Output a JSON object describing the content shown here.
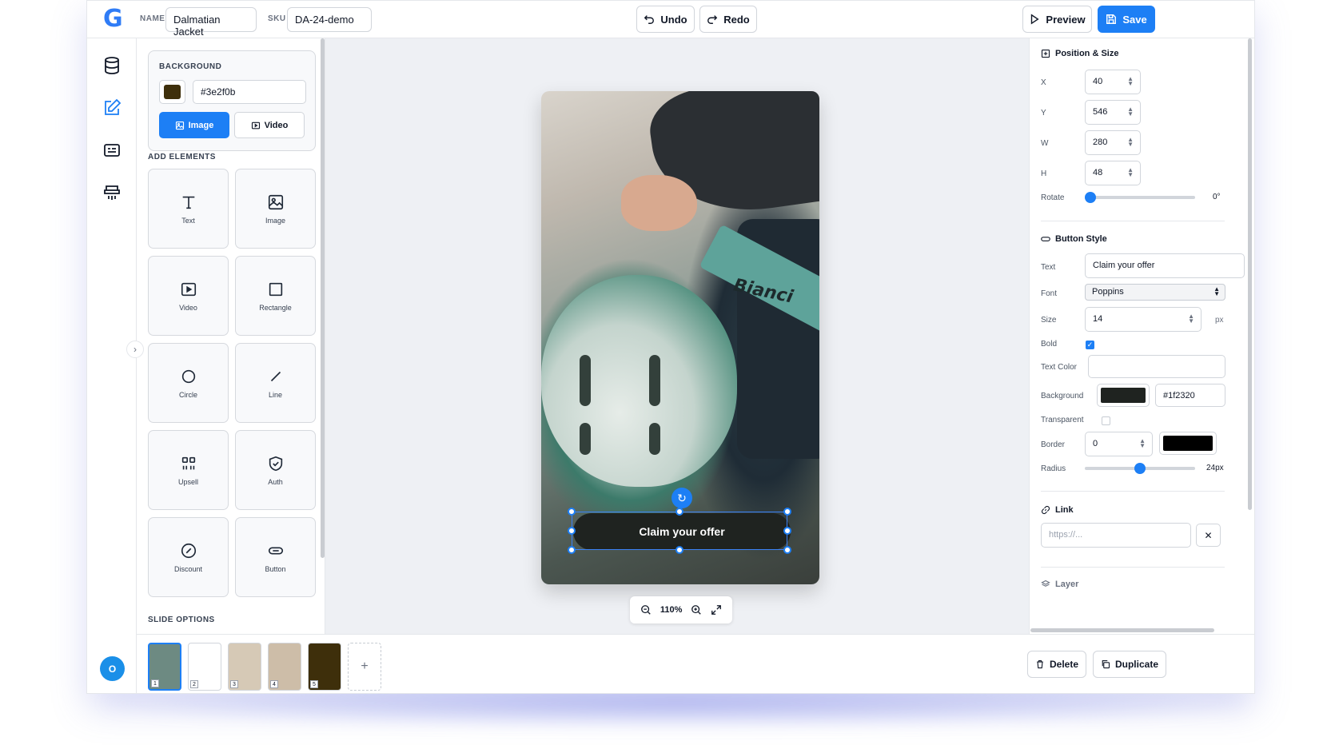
{
  "brand": {
    "logo_glyph": "G",
    "accent": "#1d7ff5"
  },
  "header": {
    "name_label": "NAME",
    "name_value": "Dalmatian Jacket",
    "sku_label": "SKU",
    "sku_value": "DA-24-demo",
    "undo_label": "Undo",
    "redo_label": "Redo",
    "preview_label": "Preview",
    "save_label": "Save"
  },
  "rail": {
    "items": [
      "database-icon",
      "edit-icon",
      "card-icon",
      "upload-icon"
    ],
    "active": "edit-icon",
    "avatar_initial": "O"
  },
  "left_panel": {
    "background": {
      "title": "BACKGROUND",
      "color_hex": "#3e2f0b",
      "image_label": "Image",
      "video_label": "Video"
    },
    "add_elements_title": "ADD ELEMENTS",
    "elements": [
      {
        "label": "Text",
        "icon": "text-icon"
      },
      {
        "label": "Image",
        "icon": "image-icon"
      },
      {
        "label": "Video",
        "icon": "video-icon"
      },
      {
        "label": "Rectangle",
        "icon": "rectangle-icon"
      },
      {
        "label": "Circle",
        "icon": "circle-icon"
      },
      {
        "label": "Line",
        "icon": "line-icon"
      },
      {
        "label": "Upsell",
        "icon": "upsell-icon"
      },
      {
        "label": "Auth",
        "icon": "shield-icon"
      },
      {
        "label": "Discount",
        "icon": "discount-icon"
      },
      {
        "label": "Button",
        "icon": "button-icon"
      }
    ],
    "slide_options_title": "SLIDE OPTIONS"
  },
  "canvas": {
    "cta_text": "Claim your offer",
    "product_brand_text": "Bianci",
    "zoom": "110%"
  },
  "right_panel": {
    "position": {
      "title": "Position & Size",
      "x_label": "X",
      "x_value": "40",
      "y_label": "Y",
      "y_value": "546",
      "w_label": "W",
      "w_value": "280",
      "h_label": "H",
      "h_value": "48",
      "rotate_label": "Rotate",
      "rotate_value": "0°",
      "rotate_level": 0
    },
    "button_style": {
      "title": "Button Style",
      "text_label": "Text",
      "text_value": "Claim your offer",
      "font_label": "Font",
      "font_value": "Poppins",
      "size_label": "Size",
      "size_value": "14",
      "size_unit": "px",
      "bold_label": "Bold",
      "bold_checked": true,
      "text_color_label": "Text Color",
      "background_label": "Background",
      "background_hex": "#1f2320",
      "transparent_label": "Transparent",
      "transparent_checked": false,
      "border_label": "Border",
      "border_value": "0",
      "border_color": "#000000",
      "radius_label": "Radius",
      "radius_value": "24px",
      "radius_level": 0.5
    },
    "link": {
      "title": "Link",
      "placeholder": "https://...",
      "clear_glyph": "✕"
    },
    "layer_title": "Layer"
  },
  "slides": {
    "items": [
      {
        "num": "1",
        "color": "#6d8a82",
        "active": true
      },
      {
        "num": "2",
        "color": "#ffffff",
        "active": false
      },
      {
        "num": "3",
        "color": "#d6c9b6",
        "active": false
      },
      {
        "num": "4",
        "color": "#cdbda8",
        "active": false
      },
      {
        "num": "5",
        "color": "#3e2f0b",
        "active": false
      }
    ],
    "add_glyph": "+",
    "delete_label": "Delete",
    "duplicate_label": "Duplicate"
  }
}
